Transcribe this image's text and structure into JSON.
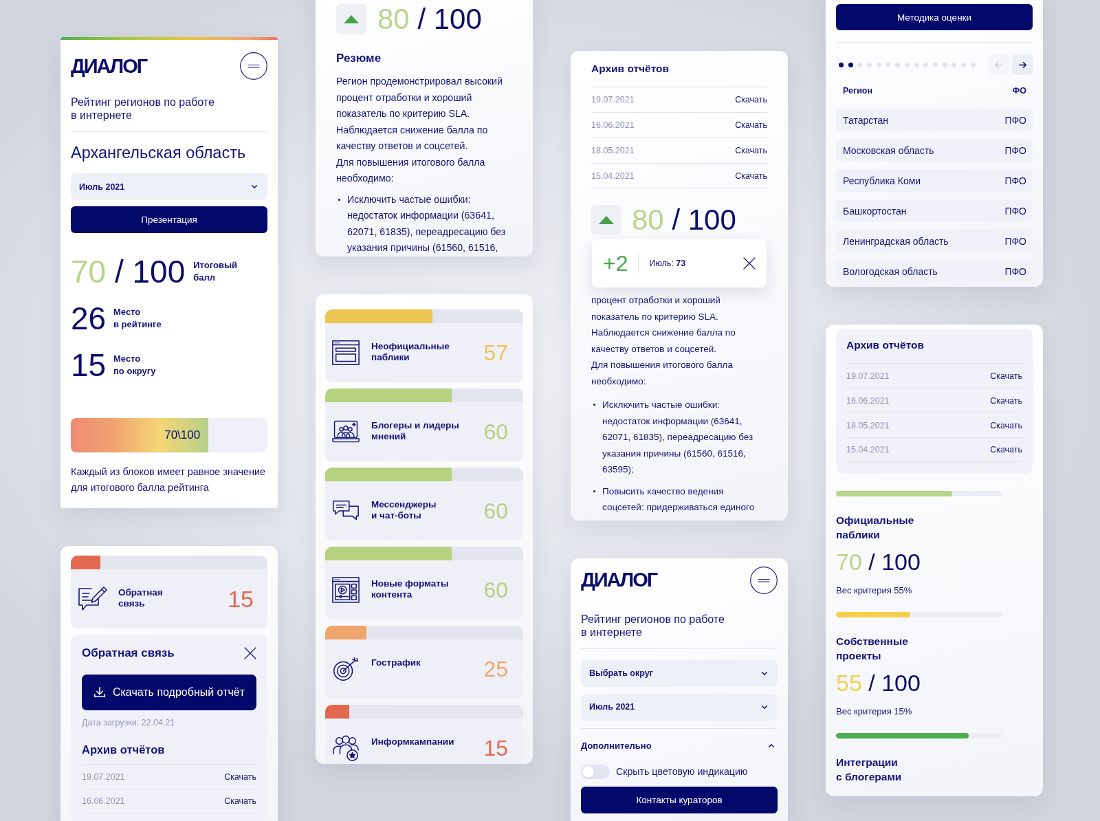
{
  "rating_card": {
    "logo": "ДИАЛОГ",
    "subtitle": "Рейтинг регионов по работе\nв интернете",
    "region_title": "Архангельская область",
    "month_select": {
      "value": "Июль 2021"
    },
    "presentation_button": "Презентация",
    "total_score": {
      "score": "70",
      "total": "/ 100",
      "color": "#b8d58a",
      "label": "Итоговый\nбалл"
    },
    "places": [
      {
        "value": "26",
        "label": "Место\nв рейтинге"
      },
      {
        "value": "15",
        "label": "Место\nпо округу"
      }
    ],
    "score_bar": {
      "level": 0.7,
      "reading": "70\\100"
    },
    "note": "Каждый из блоков имеет равное значение для итогового балла рейтинга"
  },
  "feedback_card": {
    "category": {
      "label": "Обратная\nсвязь",
      "score": "15",
      "level": 0.15,
      "color": "#e2694f"
    },
    "panel": {
      "title": "Обратная связь",
      "download_button": "Скачать подробный отчёт",
      "upload_date": "Дата загрузки: 22.04.21",
      "archive": {
        "title": "Архив отчётов",
        "rows": [
          {
            "date": "19.07.2021",
            "action": "Скачать"
          },
          {
            "date": "16.06.2021",
            "action": "Скачать"
          }
        ]
      }
    }
  },
  "summary_card": {
    "score": {
      "rising": true,
      "score": "80",
      "total": "/ 100",
      "color": "#b8d58a"
    },
    "title": "Резюме",
    "paragraphs": [
      "Регион продемонстрировал высокий процент отработки и хороший показатель по критерию SLA.",
      "Наблюдается снижение балла по качеству ответов и соцсетей.",
      "Для повышения итогового балла необходимо:"
    ],
    "bullets": [
      "Исключить частые ошибки: недостаток информации (63641, 62071, 61835), переадресацию без указания причины (61560, 61516,"
    ]
  },
  "categories_card": {
    "items": [
      {
        "label": "Неофициальные\nпаблики",
        "score": "57",
        "level": 0.54,
        "color": "#ecc452"
      },
      {
        "label": "Блогеры и лидеры\nмнений",
        "score": "60",
        "level": 0.64,
        "color": "#b6d17f"
      },
      {
        "label": "Мессенджеры\nи чат-боты",
        "score": "60",
        "level": 0.64,
        "color": "#b6d17f"
      },
      {
        "label": "Новые форматы\nконтента",
        "score": "60",
        "level": 0.64,
        "color": "#b6d17f"
      },
      {
        "label": "Гострафик",
        "score": "25",
        "level": 0.21,
        "color": "#eea56c"
      },
      {
        "label": "Информкампании",
        "score": "15",
        "level": 0.12,
        "color": "#e2694f"
      }
    ]
  },
  "archive_card": {
    "archive": {
      "title": "Архив отчётов",
      "rows": [
        {
          "date": "19.07.2021",
          "action": "Скачать"
        },
        {
          "date": "16.06.2021",
          "action": "Скачать"
        },
        {
          "date": "18.05.2021",
          "action": "Скачать"
        },
        {
          "date": "15.04.2021",
          "action": "Скачать"
        }
      ]
    },
    "score": {
      "rising": true,
      "score": "80",
      "total": "/ 100",
      "color": "#b8d58a"
    },
    "change_popup": {
      "delta": "+2",
      "period": "Июль: **73**"
    },
    "paragraphs": [
      "процент отработки и хороший показатель по критерию SLA.",
      "Наблюдается снижение балла по качеству ответов и соцсетей.",
      "Для повышения итогового балла необходимо:"
    ],
    "bullets": [
      "Исключить частые ошибки: недостаток информации (63641, 62071, 61835), переадресацию без указания причины (61560, 61516, 63595);",
      "Повысить качество ведения соцсетей: придерживаться единого"
    ]
  },
  "menu_card": {
    "logo": "ДИАЛОГ",
    "subtitle": "Рейтинг регионов по работе\nв интернете",
    "selects": [
      {
        "placeholder": "Выбрать округ"
      },
      {
        "value": "Июль 2021"
      }
    ],
    "section": {
      "title": "Дополнительно",
      "expanded": true
    },
    "toggle": {
      "label": "Скрыть цветовую индикацию",
      "on": false
    },
    "contacts_button": "Контакты кураторов"
  },
  "regions_card": {
    "method_button": "Методика оценки",
    "pagination": {
      "dots": [
        {
          "selected": true
        },
        {
          "selected": true
        },
        {
          "selected": false
        },
        {
          "selected": false
        },
        {
          "selected": false
        },
        {
          "selected": false
        },
        {
          "selected": false
        },
        {
          "selected": false
        },
        {
          "selected": false
        },
        {
          "selected": false
        },
        {
          "selected": false
        },
        {
          "selected": false
        },
        {
          "selected": false
        },
        {
          "selected": false
        },
        {
          "selected": false
        }
      ],
      "prev": {
        "disabled": true
      },
      "next": {
        "disabled": false
      }
    },
    "table": {
      "columns": [
        "Регион",
        "ФО"
      ],
      "rows": [
        [
          "Татарстан",
          "ПФО"
        ],
        [
          "Московская область",
          "ПФО"
        ],
        [
          "Республика Коми",
          "ПФО"
        ],
        [
          "Башкортостан",
          "ПФО"
        ],
        [
          "Ленинградская область",
          "ПФО"
        ],
        [
          "Вологодская область",
          "ПФО"
        ]
      ]
    }
  },
  "criteria_card": {
    "archive": {
      "title": "Архив отчётов",
      "rows": [
        {
          "date": "19.07.2021",
          "action": "Скачать"
        },
        {
          "date": "16.06.2021",
          "action": "Скачать"
        },
        {
          "date": "18.05.2021",
          "action": "Скачать"
        },
        {
          "date": "15.04.2021",
          "action": "Скачать"
        }
      ]
    },
    "criteria": [
      {
        "level": 0.7,
        "color": "#b8d58a",
        "label": "Официальные\nпаблики",
        "score": "70",
        "total": "/ 100",
        "weight": "Вес критерия 55%"
      },
      {
        "level": 0.45,
        "color": "#f4cf4f",
        "label": "Собственные\nпроекты",
        "score": "55",
        "total": "/ 100",
        "weight": "Вес критерия 15%"
      },
      {
        "level": 0.8,
        "color": "#4cae4f",
        "label": "Интеграции\nс блогерами"
      }
    ]
  }
}
